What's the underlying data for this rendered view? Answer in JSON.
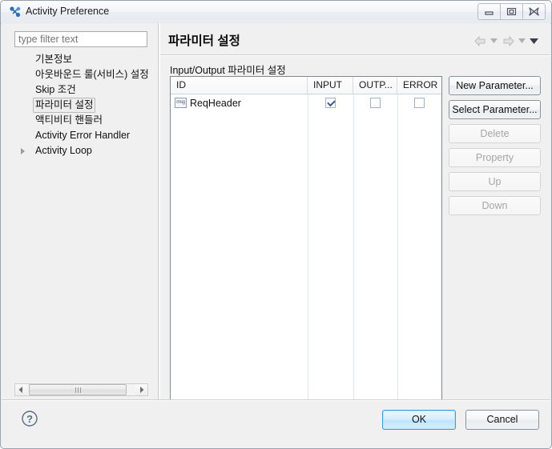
{
  "window": {
    "title": "Activity Preference",
    "icon": "activity-node-icon",
    "controls": {
      "minimize": "minimize-icon",
      "restore": "restore-icon",
      "close": "close-icon"
    }
  },
  "sidebar": {
    "filter": {
      "placeholder": "type filter text",
      "value": ""
    },
    "items": [
      {
        "label": "기본정보",
        "selected": false,
        "expandable": false
      },
      {
        "label": "아웃바운드 룰(서비스) 설정",
        "selected": false,
        "expandable": false
      },
      {
        "label": "Skip 조건",
        "selected": false,
        "expandable": false
      },
      {
        "label": "파라미터 설정",
        "selected": true,
        "expandable": false
      },
      {
        "label": "액티비티 핸들러",
        "selected": false,
        "expandable": false
      },
      {
        "label": "Activity Error Handler",
        "selected": false,
        "expandable": false
      },
      {
        "label": "Activity Loop",
        "selected": false,
        "expandable": true
      }
    ],
    "scrollbar": {
      "left_arrow": "triangle-left-icon",
      "right_arrow": "triangle-right-icon",
      "grip": "scrollbar-grip-icon"
    }
  },
  "main": {
    "page_title": "파라미터 설정",
    "nav": {
      "back": "arrow-left-icon",
      "back_menu": "chevron-down-icon",
      "forward": "arrow-right-icon",
      "forward_menu": "chevron-down-icon",
      "view_menu": "chevron-down-filled-icon"
    },
    "group_label": "Input/Output 파라미터 설정",
    "table": {
      "columns": [
        "ID",
        "INPUT",
        "OUTP...",
        "ERROR"
      ],
      "rows": [
        {
          "icon": "msg-icon",
          "icon_text": "msg",
          "id": "ReqHeader",
          "input": true,
          "output": false,
          "error": false
        }
      ]
    },
    "buttons": [
      {
        "label": "New Parameter...",
        "enabled": true
      },
      {
        "label": "Select Parameter...",
        "enabled": true
      },
      {
        "label": "Delete",
        "enabled": false
      },
      {
        "label": "Property",
        "enabled": false
      },
      {
        "label": "Up",
        "enabled": false
      },
      {
        "label": "Down",
        "enabled": false
      }
    ]
  },
  "footer": {
    "help": "help-question-icon",
    "ok": "OK",
    "cancel": "Cancel"
  }
}
